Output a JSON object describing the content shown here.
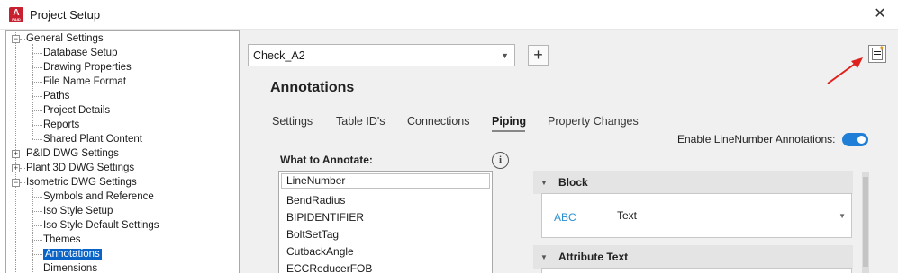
{
  "window": {
    "app_icon_letter": "A",
    "app_icon_sub": "P&ID",
    "title": "Project Setup",
    "close": "✕"
  },
  "tree": [
    {
      "label": "General Settings",
      "level": 0,
      "toggle": "−"
    },
    {
      "label": "Database Setup",
      "level": 1
    },
    {
      "label": "Drawing Properties",
      "level": 1
    },
    {
      "label": "File Name Format",
      "level": 1
    },
    {
      "label": "Paths",
      "level": 1
    },
    {
      "label": "Project Details",
      "level": 1
    },
    {
      "label": "Reports",
      "level": 1
    },
    {
      "label": "Shared Plant Content",
      "level": 1
    },
    {
      "label": "P&ID DWG Settings",
      "level": 0,
      "toggle": "+"
    },
    {
      "label": "Plant 3D DWG Settings",
      "level": 0,
      "toggle": "+"
    },
    {
      "label": "Isometric DWG Settings",
      "level": 0,
      "toggle": "−"
    },
    {
      "label": "Symbols and Reference",
      "level": 1
    },
    {
      "label": "Iso Style Setup",
      "level": 1
    },
    {
      "label": "Iso Style Default Settings",
      "level": 1
    },
    {
      "label": "Themes",
      "level": 1
    },
    {
      "label": "Annotations",
      "level": 1,
      "selected": true
    },
    {
      "label": "Dimensions",
      "level": 1
    }
  ],
  "style_combo": {
    "value": "Check_A2",
    "arrow": "▼"
  },
  "add_button": "+",
  "page_heading": "Annotations",
  "tabs": [
    "Settings",
    "Table ID's",
    "Connections",
    "Piping",
    "Property Changes"
  ],
  "active_tab": "Piping",
  "enable_toggle": {
    "label": "Enable LineNumber Annotations:",
    "on": true,
    "color": "#1f7fd6"
  },
  "what_to_annotate": {
    "label": "What to Annotate:",
    "info": "i",
    "filter_value": "LineNumber",
    "items": [
      "BendRadius",
      "BIPIDENTIFIER",
      "BoltSetTag",
      "CutbackAngle",
      "ECCReducerFOB"
    ]
  },
  "block_panel": {
    "caret": "▼",
    "header": "Block",
    "preview": "ABC",
    "type": "Text",
    "arrow": "▼"
  },
  "attribute_panel": {
    "caret": "▼",
    "header": "Attribute Text"
  },
  "colors": {
    "selection": "#0a64c8",
    "accent_arrow": "#e0201a",
    "abc_blue": "#2a8fd0"
  }
}
